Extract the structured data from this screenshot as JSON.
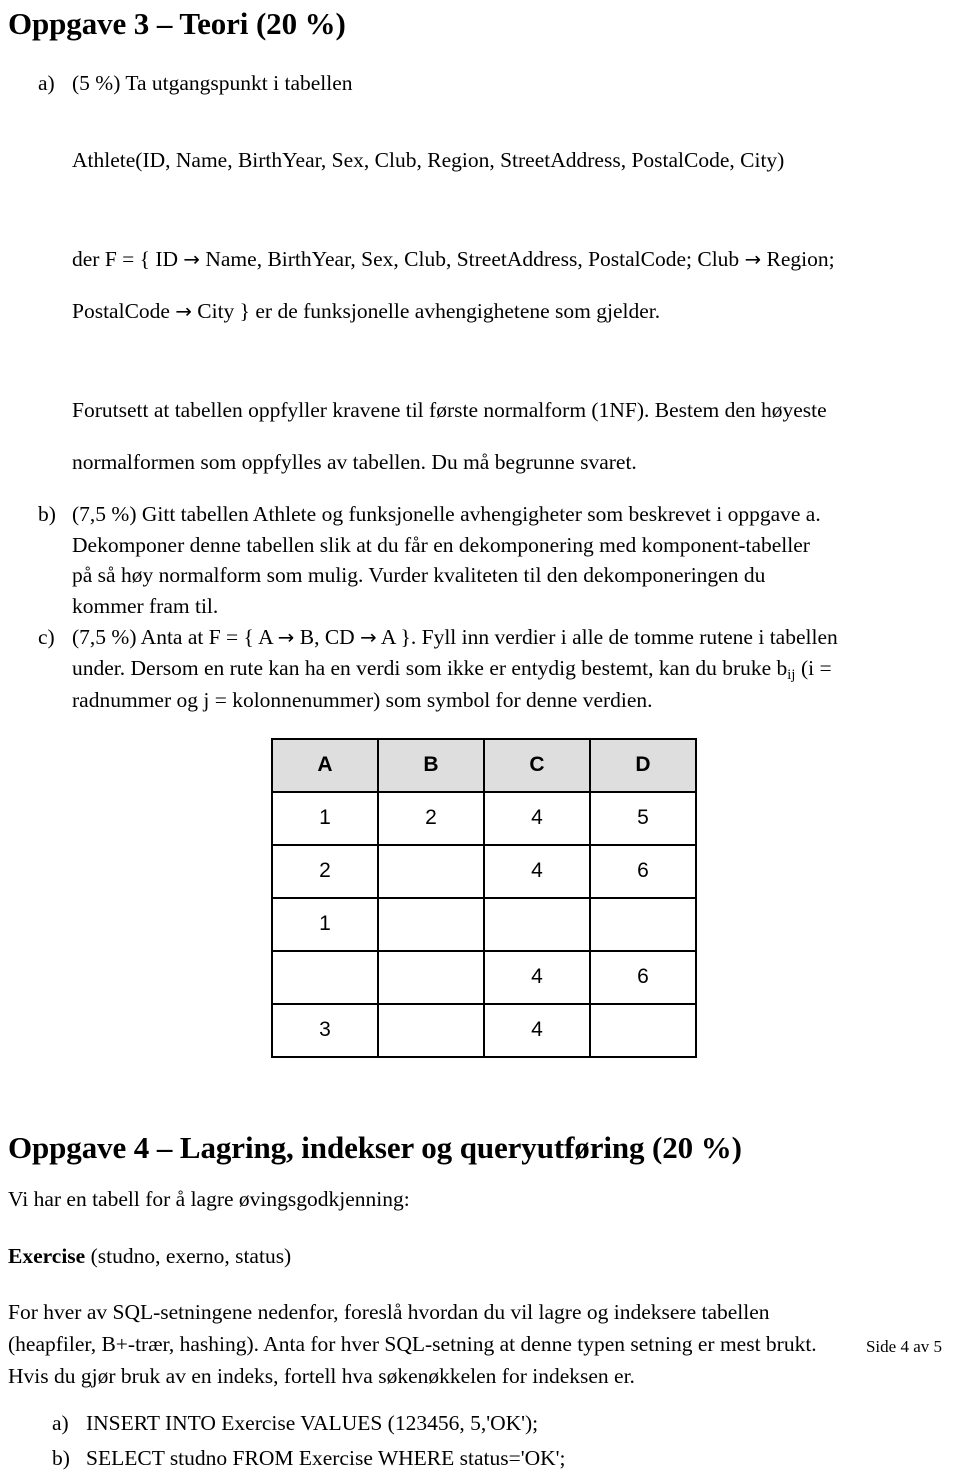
{
  "document": {
    "footer": "Side 4 av 5"
  },
  "oppgave3": {
    "heading": "Oppgave 3 – Teori (20 %)",
    "item_a": {
      "marker": "a)",
      "line1": "(5 %) Ta utgangspunkt i tabellen",
      "relation": "Athlete(ID, Name, BirthYear, Sex, Club, Region, StreetAddress, PostalCode, City)",
      "fd_line1_pre": "der F = { ID ",
      "fd_arrow1": "→",
      "fd_line1_mid": " Name, BirthYear, Sex, Club, StreetAddress, PostalCode; Club ",
      "fd_arrow2": "→",
      "fd_line1_post": " Region;",
      "fd_line2_pre": "PostalCode ",
      "fd_arrow3": "→",
      "fd_line2_post": " City } er de funksjonelle avhengighetene som gjelder.",
      "para2_line1": "Forutsett at tabellen oppfyller kravene til første normalform (1NF). Bestem den høyeste",
      "para2_line2": "normalformen som oppfylles av tabellen. Du må begrunne svaret."
    },
    "item_b": {
      "marker": "b)",
      "line1": "(7,5 %) Gitt tabellen Athlete og funksjonelle avhengigheter som beskrevet i oppgave a.",
      "line2": "Dekomponer denne tabellen slik at du får en dekomponering med komponent-tabeller",
      "line3": "på så høy normalform som mulig. Vurder kvaliteten til den dekomponeringen du",
      "line4": "kommer fram til."
    },
    "item_c": {
      "marker": "c)",
      "line1_pre": "(7,5 %) Anta at F = { A ",
      "arrow1": "→",
      "line1_mid": " B, CD ",
      "arrow2": "→",
      "line1_post": " A }. Fyll inn verdier i alle de tomme rutene i tabellen",
      "line2_pre": "under. Dersom en rute kan ha en verdi som ikke er entydig bestemt, kan du bruke b",
      "line2_sub": "ij",
      "line2_post": " (i =",
      "line3": "radnummer og j = kolonnenummer) som symbol for denne verdien."
    },
    "table": {
      "headers": [
        "A",
        "B",
        "C",
        "D"
      ],
      "rows": [
        [
          "1",
          "2",
          "4",
          "5"
        ],
        [
          "2",
          "",
          "4",
          "6"
        ],
        [
          "1",
          "",
          "",
          ""
        ],
        [
          "",
          "",
          "4",
          "6"
        ],
        [
          "3",
          "",
          "4",
          ""
        ]
      ]
    }
  },
  "oppgave4": {
    "heading": "Oppgave 4 – Lagring, indekser og queryutføring (20 %)",
    "intro": "Vi har en tabell for å lagre øvingsgodkjenning:",
    "relation_bold": "Exercise",
    "relation_rest": " (studno, exerno, status)",
    "para_line1": "For hver av SQL-setningene nedenfor, foreslå hvordan du vil lagre og indeksere tabellen",
    "para_line2": "(heapfiler, B+-trær, hashing). Anta for hver SQL-setning at denne typen setning er mest brukt.",
    "para_line3": "Hvis du gjør bruk av en indeks, fortell hva søkenøkkelen for indeksen er.",
    "items": [
      {
        "marker": "a)",
        "text": "INSERT INTO Exercise VALUES (123456, 5,'OK');"
      },
      {
        "marker": "b)",
        "text": "SELECT studno FROM Exercise WHERE status='OK';"
      }
    ]
  }
}
